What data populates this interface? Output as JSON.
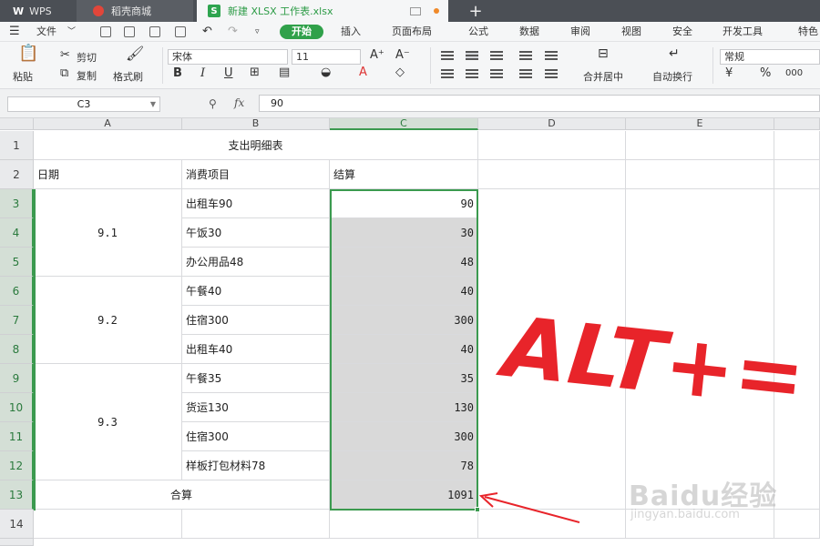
{
  "tabs": {
    "wps": "WPS",
    "store": "稻壳商城",
    "document": "新建 XLSX 工作表.xlsx",
    "new_tab": "+"
  },
  "menu": {
    "file": "文件",
    "items": [
      "开始",
      "插入",
      "页面布局",
      "公式",
      "数据",
      "审阅",
      "视图",
      "安全",
      "开发工具",
      "特色"
    ]
  },
  "ribbon": {
    "paste": "粘贴",
    "cut": "剪切",
    "copy": "复制",
    "format_painter": "格式刷",
    "font_name": "宋体",
    "font_size": "11",
    "merge_center": "合并居中",
    "wrap_text": "自动换行",
    "number_format": "常规",
    "percent": "%",
    "thousands": "000"
  },
  "formula_bar": {
    "name_box": "C3",
    "fx": "fx",
    "value": "90"
  },
  "columns": [
    "A",
    "B",
    "C",
    "D",
    "E"
  ],
  "rows": [
    "1",
    "2",
    "3",
    "4",
    "5",
    "6",
    "7",
    "8",
    "9",
    "10",
    "11",
    "12",
    "13",
    "14"
  ],
  "sheet": {
    "title": "支出明细表",
    "headers": {
      "date": "日期",
      "item": "消费项目",
      "amount": "结算"
    },
    "groups": [
      "9.1",
      "9.2",
      "9.3"
    ],
    "items": [
      "出租车90",
      "午饭30",
      "办公用品48",
      "午餐40",
      "住宿300",
      "出租车40",
      "午餐35",
      "货运130",
      "住宿300",
      "样板打包材料78"
    ],
    "amounts": [
      "90",
      "30",
      "48",
      "40",
      "300",
      "40",
      "35",
      "130",
      "300",
      "78"
    ],
    "total_label": "合算",
    "total": "1091"
  },
  "annotation": {
    "text": "ALT+=",
    "color": "#e8242a"
  },
  "watermark": {
    "main": "Baidu经验",
    "sub": "jingyan.baidu.com"
  },
  "colors": {
    "accent": "#3b9a4f",
    "tab_bar": "#4b4f55",
    "selection_fill": "#d9d9d9"
  }
}
